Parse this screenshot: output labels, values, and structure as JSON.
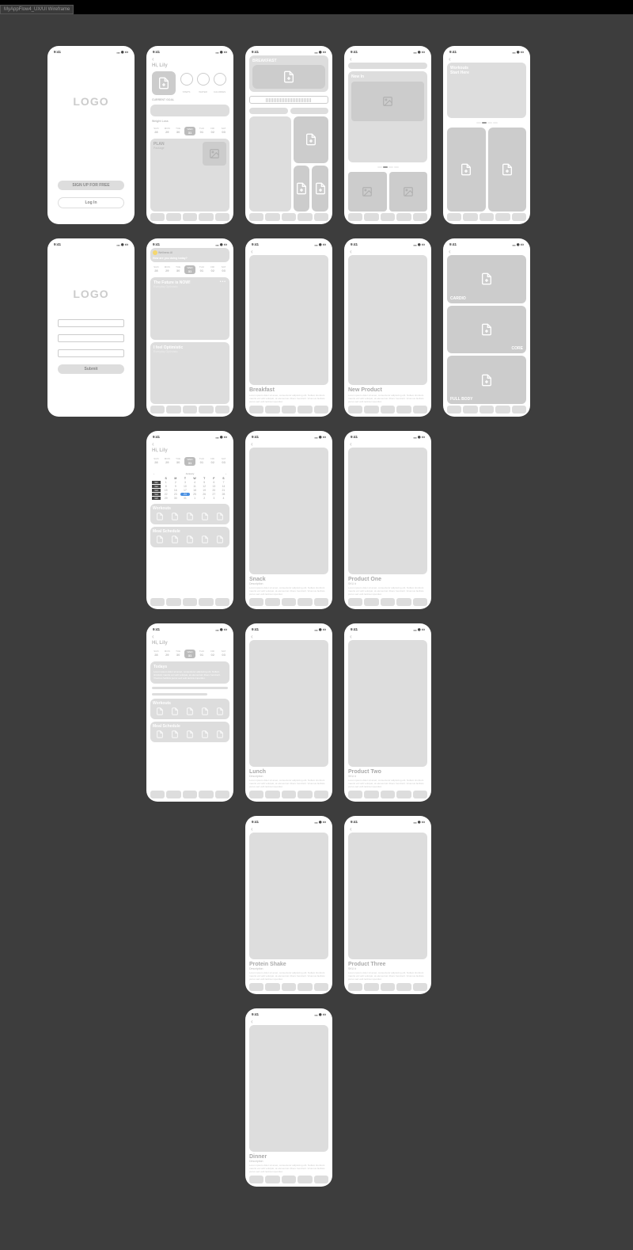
{
  "tab": "MyAppFlow4_UX/UI Wireframe",
  "time": "9:41",
  "logo": "LOGO",
  "signup": "SIGN UP FOR FREE",
  "login": "Log In",
  "submit": "Submit",
  "greeting": "Hi, Lily",
  "circles": [
    "STEPS",
    "WATER",
    "CALORIES"
  ],
  "labels": {
    "current": "CURRENT GOAL",
    "weight": "Weight Loss",
    "plan": "PLAN",
    "todays": "Todays",
    "workouts": "Workouts",
    "meals": "Meal Schedule"
  },
  "days": {
    "names": [
      "SUN",
      "MON",
      "TUE",
      "WED",
      "THU",
      "FRI",
      "SAT"
    ],
    "nums": [
      "28",
      "29",
      "30",
      "31",
      "01",
      "02",
      "03"
    ],
    "sel": 3
  },
  "cal": {
    "month": "January",
    "year": "2024",
    "weeks": [
      [
        "W1",
        "1",
        "2",
        "3",
        "4",
        "5",
        "6",
        "7"
      ],
      [
        "W2",
        "8",
        "9",
        "10",
        "11",
        "12",
        "13",
        "14"
      ],
      [
        "W3",
        "15",
        "16",
        "17",
        "18",
        "19",
        "20",
        "21"
      ],
      [
        "W4",
        "22",
        "23",
        "24",
        "25",
        "26",
        "27",
        "28"
      ],
      [
        "W5",
        "29",
        "30",
        "31",
        "1",
        "2",
        "3",
        "4"
      ]
    ],
    "today": "24"
  },
  "chat": {
    "name": "Wellness AI",
    "q": "How are you doing today?"
  },
  "mood1": {
    "t": "The Future is NOW!",
    "s": "Everyday Optimistic"
  },
  "mood2": {
    "t": "I feel Optimistic",
    "s": "Everyday Optimistic"
  },
  "meals": {
    "breakfast": "BREAKFAST",
    "b2": "Breakfast",
    "snack": "Snack",
    "lunch": "Lunch",
    "shake": "Protein Shake",
    "dinner": "Dinner",
    "desc": "Description"
  },
  "shop": {
    "newin": "New In",
    "np": "New Product",
    "p1": "Product One",
    "p2": "Product Two",
    "p3": "Product Three",
    "sku": "SKU #"
  },
  "workout": {
    "start": "Workouts\nStart Here",
    "cardio": "CARDIO",
    "core": "CORE",
    "full": "FULL BODY"
  },
  "lorem": "Lorem ipsum dolor sit amet, consectetur adipiscing elit. Nullam tincidunt mauris vel velit volutpat, at elementum libero hendrerit. Vivamus facilisis purus sed velit lacinia imperdiet."
}
